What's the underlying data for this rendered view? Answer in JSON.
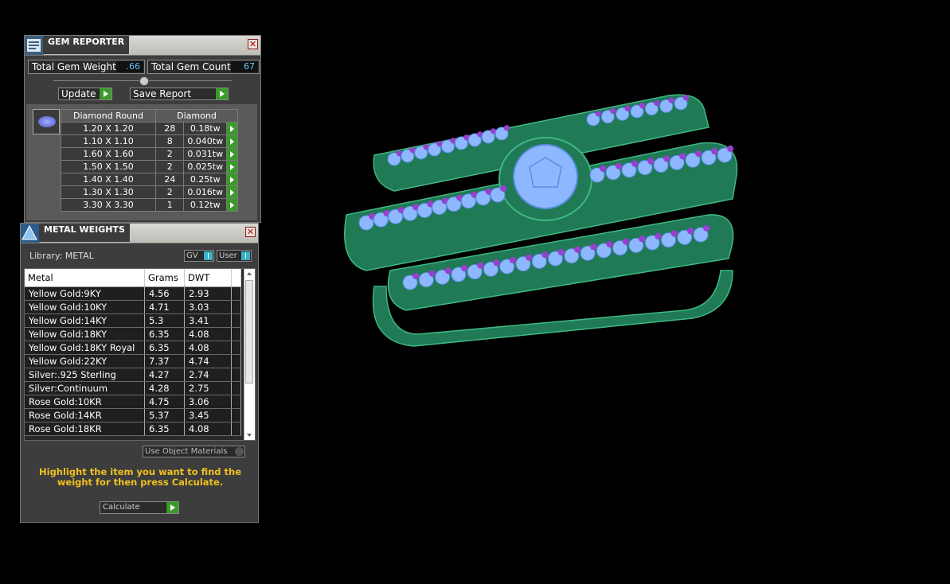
{
  "gem_reporter": {
    "title": "GEM REPORTER",
    "total_weight_label": "Total Gem Weight",
    "total_weight_value": ".66",
    "total_count_label": "Total Gem Count",
    "total_count_value": "67",
    "update_label": "Update",
    "save_label": "Save Report",
    "table_headers": [
      "Diamond Round",
      "Diamond"
    ],
    "rows": [
      {
        "size": "1.20 X 1.20",
        "count": "28",
        "weight": "0.18tw"
      },
      {
        "size": "1.10 X 1.10",
        "count": "8",
        "weight": "0.040tw"
      },
      {
        "size": "1.60 X 1.60",
        "count": "2",
        "weight": "0.031tw"
      },
      {
        "size": "1.50 X 1.50",
        "count": "2",
        "weight": "0.025tw"
      },
      {
        "size": "1.40 X 1.40",
        "count": "24",
        "weight": "0.25tw"
      },
      {
        "size": "1.30 X 1.30",
        "count": "2",
        "weight": "0.016tw"
      },
      {
        "size": "3.30 X 3.30",
        "count": "1",
        "weight": "0.12tw"
      }
    ]
  },
  "metal_weights": {
    "title": "METAL WEIGHTS",
    "library": "Library: METAL",
    "gv_label": "GV",
    "user_label": "User",
    "columns": [
      "Metal",
      "Grams",
      "DWT"
    ],
    "rows": [
      {
        "metal": "Yellow Gold:9KY",
        "grams": "4.56",
        "dwt": "2.93"
      },
      {
        "metal": "Yellow Gold:10KY",
        "grams": "4.71",
        "dwt": "3.03"
      },
      {
        "metal": "Yellow Gold:14KY",
        "grams": "5.3",
        "dwt": "3.41"
      },
      {
        "metal": "Yellow Gold:18KY",
        "grams": "6.35",
        "dwt": "4.08"
      },
      {
        "metal": "Yellow Gold:18KY Royal",
        "grams": "6.35",
        "dwt": "4.08"
      },
      {
        "metal": "Yellow Gold:22KY",
        "grams": "7.37",
        "dwt": "4.74"
      },
      {
        "metal": "Silver:.925 Sterling",
        "grams": "4.27",
        "dwt": "2.74"
      },
      {
        "metal": "Silver:Continuum",
        "grams": "4.28",
        "dwt": "2.75"
      },
      {
        "metal": "Rose Gold:10KR",
        "grams": "4.75",
        "dwt": "3.06"
      },
      {
        "metal": "Rose Gold:14KR",
        "grams": "5.37",
        "dwt": "3.45"
      },
      {
        "metal": "Rose Gold:18KR",
        "grams": "6.35",
        "dwt": "4.08"
      }
    ],
    "use_object_materials": "Use Object Materials",
    "hint": "Highlight the item you want to find the weight for then press Calculate.",
    "calculate_label": "Calculate"
  },
  "colors": {
    "ring_body": "#1f7a55",
    "ring_edge": "#3fb884",
    "diamond": "#8db8ff",
    "prong": "#9a3fd0",
    "accent_green": "#3a9a2a",
    "hint_yellow": "#f0c020"
  }
}
